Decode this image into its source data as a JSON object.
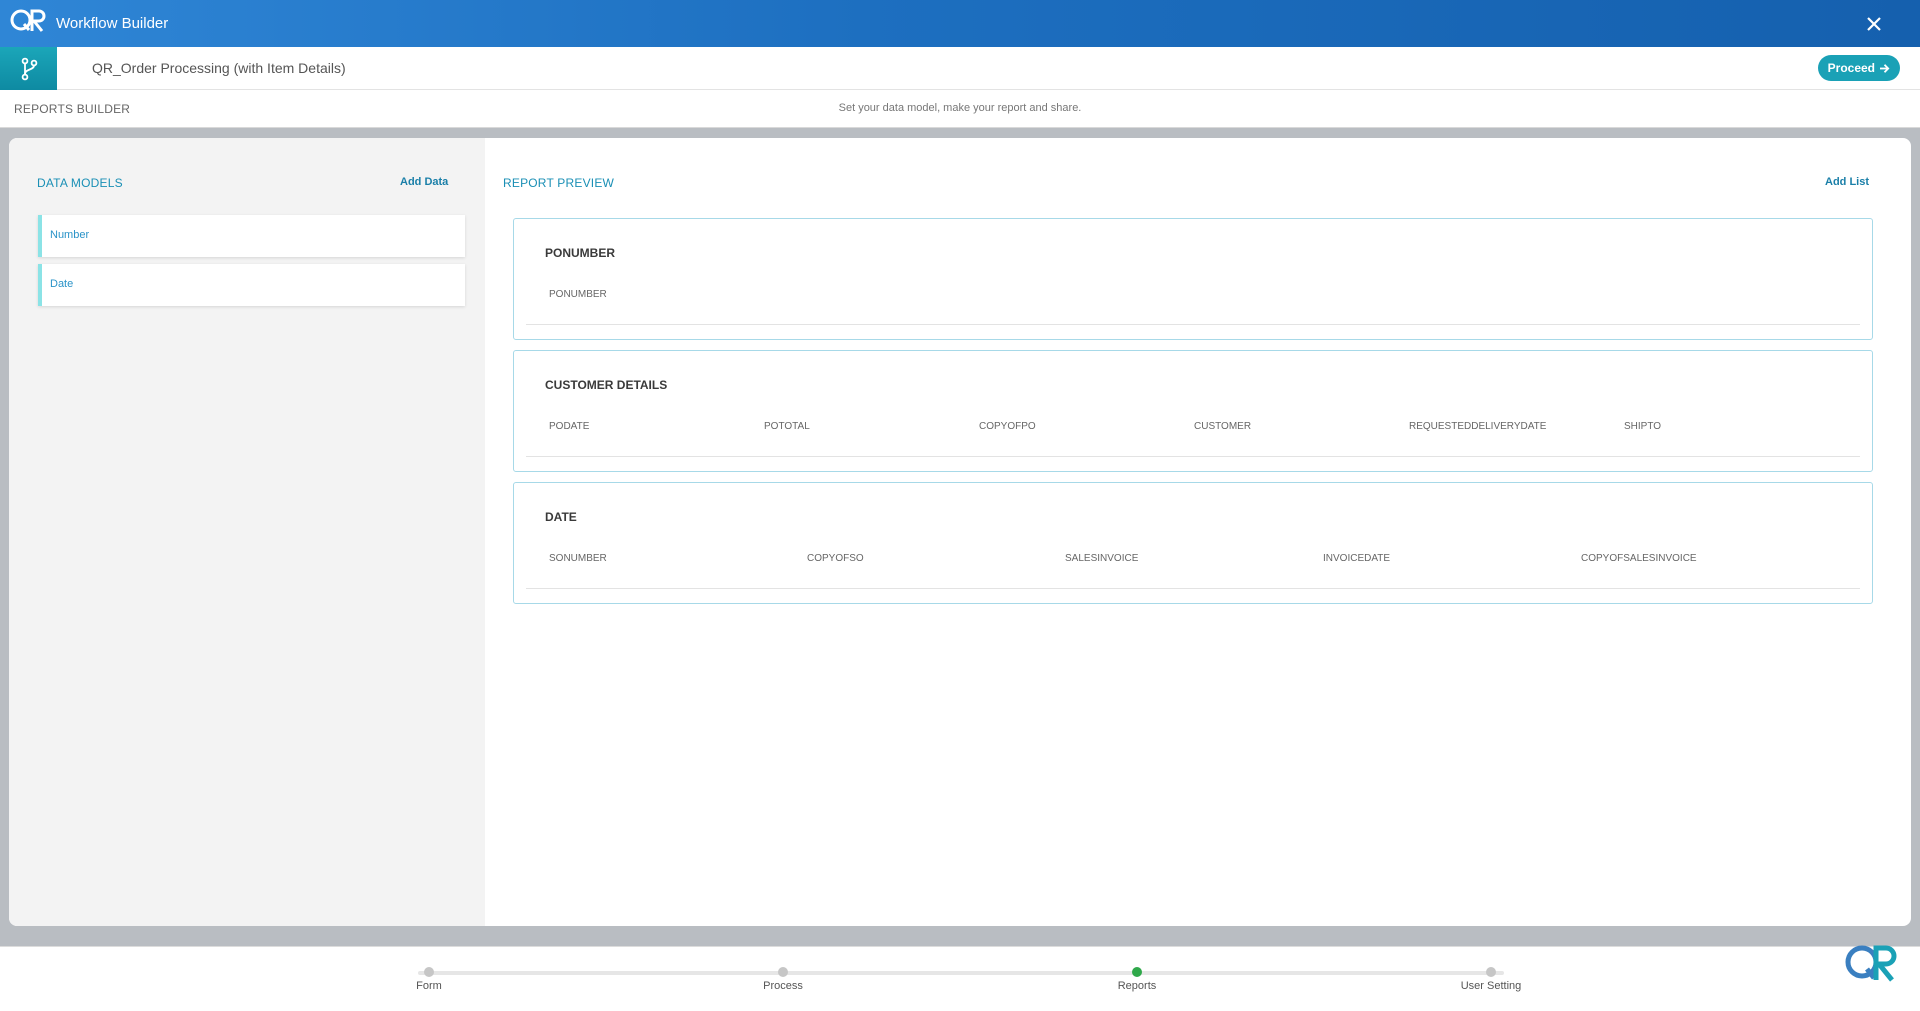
{
  "titlebar": {
    "title": "Workflow Builder"
  },
  "subbar": {
    "workflow_name": "QR_Order Processing (with Item Details)",
    "proceed_label": "Proceed"
  },
  "toolbar": {
    "title": "REPORTS BUILDER",
    "hint": "Set your data model, make your report and share."
  },
  "data_models": {
    "title": "DATA MODELS",
    "add_label": "Add Data",
    "items": [
      {
        "label": "Number"
      },
      {
        "label": "Date"
      }
    ]
  },
  "report_preview": {
    "title": "REPORT PREVIEW",
    "add_label": "Add List",
    "cards": [
      {
        "title": "PONUMBER",
        "fields": [
          "PONUMBER"
        ]
      },
      {
        "title": "CUSTOMER DETAILS",
        "fields": [
          "PODATE",
          "POTOTAL",
          "COPYOFPO",
          "CUSTOMER",
          "REQUESTEDDELIVERYDATE",
          "SHIPTO"
        ]
      },
      {
        "title": "DATE",
        "fields": [
          "SONUMBER",
          "COPYOFSO",
          "SALESINVOICE",
          "INVOICEDATE",
          "COPYOFSALESINVOICE"
        ]
      }
    ]
  },
  "steps": {
    "items": [
      {
        "label": "Form",
        "active": false
      },
      {
        "label": "Process",
        "active": false
      },
      {
        "label": "Reports",
        "active": true
      },
      {
        "label": "User Setting",
        "active": false
      }
    ]
  },
  "icons": {
    "logo": "qr-logo-icon",
    "close": "close-icon",
    "branch": "branch-icon",
    "proceed_arrow": "arrow-right-icon"
  },
  "colors": {
    "accent": "#1aa1b6",
    "header": "#1d6fc0",
    "active_step": "#2fa84a"
  }
}
